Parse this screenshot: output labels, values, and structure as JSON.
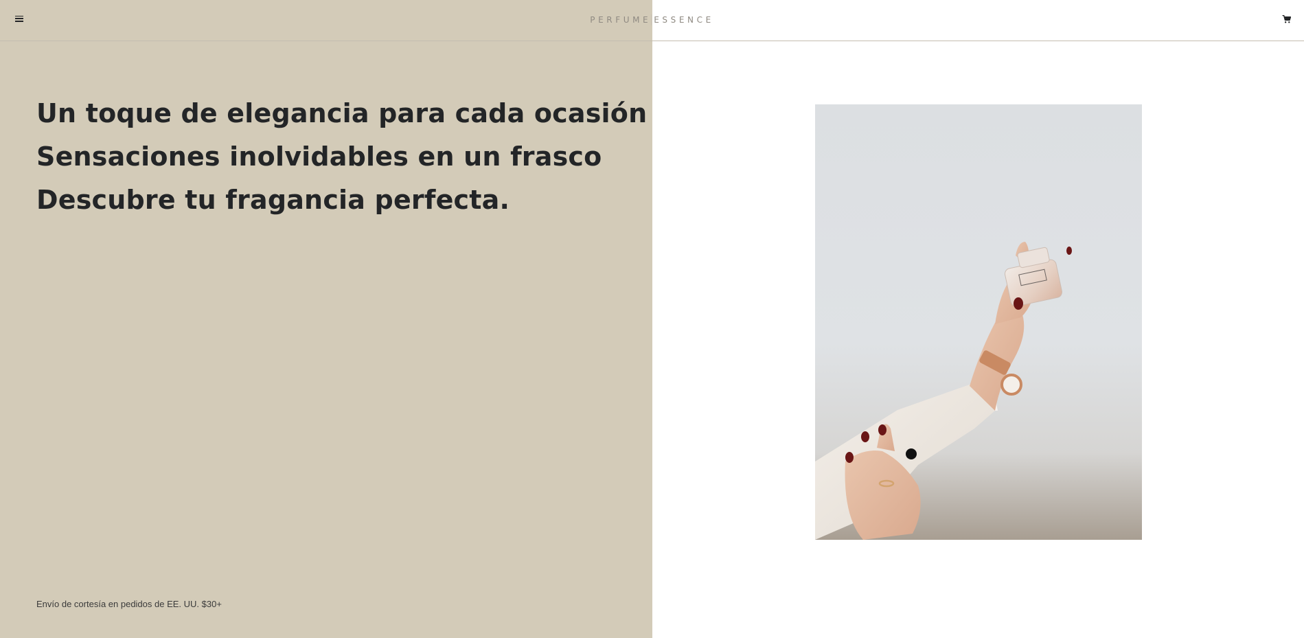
{
  "header": {
    "brand_left": "PERFUME",
    "brand_right": "ESSENCE",
    "menu_icon": "hamburger-menu-icon",
    "cart_icon": "shopping-cart-icon"
  },
  "hero": {
    "headline_lines": [
      "Un toque de elegancia para cada ocasión",
      "Sensaciones inolvidables en un frasco",
      "Descubre tu fragancia perfecta."
    ],
    "shipping_note": "Envío de cortesía en pedidos de EE. UU. $30+"
  },
  "colors": {
    "left_panel": "#d3cbb8",
    "right_panel": "#ffffff",
    "text": "#232527"
  }
}
